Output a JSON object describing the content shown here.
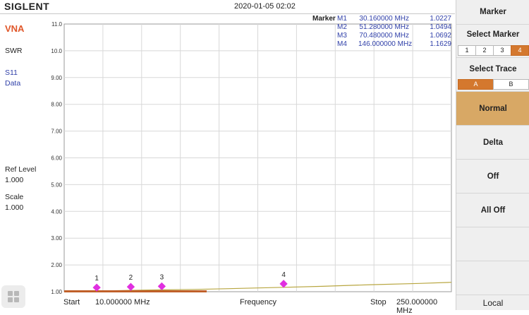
{
  "header": {
    "brand": "SIGLENT",
    "datetime": "2020-01-05 02:02"
  },
  "left_panel": {
    "mode": "VNA",
    "format": "SWR",
    "param": "S11",
    "trace_type": "Data",
    "ref_level_label": "Ref Level",
    "ref_level_value": "1.000",
    "scale_label": "Scale",
    "scale_value": "1.000"
  },
  "marker_table": {
    "title": "Marker",
    "rows": [
      {
        "name": "M1",
        "freq": "30.160000 MHz",
        "value": "1.0227"
      },
      {
        "name": "M2",
        "freq": "51.280000 MHz",
        "value": "1.0494"
      },
      {
        "name": "M3",
        "freq": "70.480000 MHz",
        "value": "1.0692"
      },
      {
        "name": "M4",
        "freq": "146.000000 MHz",
        "value": "1.1629"
      }
    ]
  },
  "bottom_bar": {
    "start_label": "Start",
    "start_value": "10.000000 MHz",
    "center_label": "Frequency",
    "stop_label": "Stop",
    "stop_value": "250.000000 MHz"
  },
  "softkeys": {
    "title": "Marker",
    "select_marker": {
      "label": "Select Marker",
      "options": [
        "1",
        "2",
        "3",
        "4"
      ],
      "selected": "4"
    },
    "select_trace": {
      "label": "Select Trace",
      "options": [
        "A",
        "B"
      ],
      "selected": "A"
    },
    "normal": "Normal",
    "delta": "Delta",
    "off": "Off",
    "all_off": "All Off",
    "local": "Local"
  },
  "colors": {
    "accent": "#d4782e",
    "trace": "#b8a640",
    "marker": "#e030e0",
    "label_blue": "#2f3fa8",
    "brand_orange": "#e0572a"
  },
  "chart_data": {
    "type": "line",
    "xlim": [
      10,
      250
    ],
    "ylim": [
      1.0,
      11.0
    ],
    "yticks": [
      "11.0",
      "10.0",
      "9.00",
      "8.00",
      "7.00",
      "6.00",
      "5.00",
      "4.00",
      "3.00",
      "2.00",
      "1.00"
    ],
    "grid": true,
    "series": [
      {
        "x": [
          10,
          30.16,
          51.28,
          70.48,
          90,
          110,
          130,
          146,
          170,
          200,
          230,
          250
        ],
        "y": [
          1.01,
          1.0227,
          1.0494,
          1.0692,
          1.085,
          1.11,
          1.14,
          1.1629,
          1.2,
          1.26,
          1.31,
          1.35
        ]
      }
    ],
    "markers": [
      {
        "label": "1",
        "x": 30.16,
        "y": 1.0227
      },
      {
        "label": "2",
        "x": 51.28,
        "y": 1.0494
      },
      {
        "label": "3",
        "x": 70.48,
        "y": 1.0692
      },
      {
        "label": "4",
        "x": 146.0,
        "y": 1.1629
      }
    ]
  }
}
